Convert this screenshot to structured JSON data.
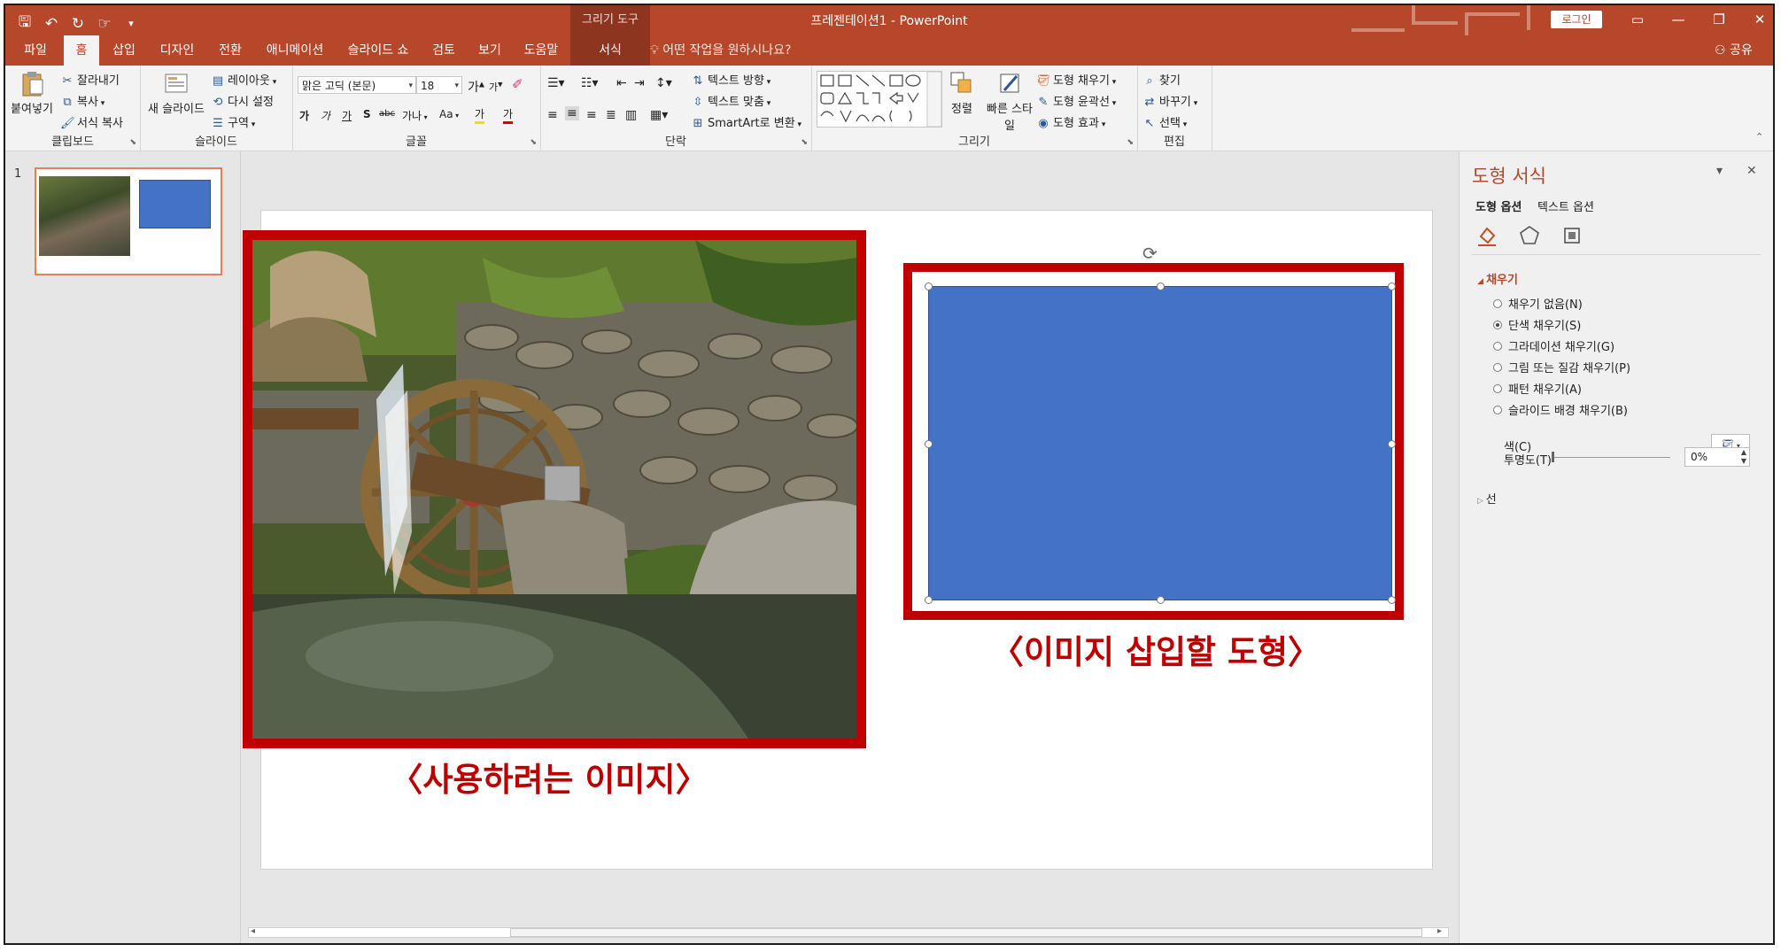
{
  "titlebar": {
    "doc_title": "프레젠테이션1 - PowerPoint",
    "context_tool": "그리기 도구",
    "login": "로그인",
    "qat": [
      "save-icon",
      "undo-icon",
      "redo-icon",
      "touch-mode-icon",
      "customize-icon"
    ]
  },
  "tabs": {
    "file": "파일",
    "home": "홈",
    "insert": "삽입",
    "design": "디자인",
    "transitions": "전환",
    "animations": "애니메이션",
    "slideshow": "슬라이드 쇼",
    "review": "검토",
    "view": "보기",
    "help": "도움말",
    "format": "서식",
    "tell_me": "어떤 작업을 원하시나요?",
    "share": "공유"
  },
  "ribbon": {
    "clipboard": {
      "label": "클립보드",
      "paste": "붙여넣기",
      "cut": "잘라내기",
      "copy": "복사",
      "format_painter": "서식 복사"
    },
    "slides": {
      "label": "슬라이드",
      "new_slide": "새 슬라이드",
      "layout": "레이아웃",
      "reset": "다시 설정",
      "section": "구역"
    },
    "font": {
      "label": "글꼴",
      "font_name": "맑은 고딕 (본문)",
      "font_size": "18",
      "grow": "가",
      "shrink": "가",
      "bold": "가",
      "italic": "가",
      "underline": "가",
      "shadow": "S",
      "strike": "abc",
      "spacing": "가나",
      "case": "Aa",
      "highlight": "가",
      "color": "가"
    },
    "paragraph": {
      "label": "단락",
      "text_direction": "텍스트 방향",
      "align_text": "텍스트 맞춤",
      "smartart": "SmartArt로 변환"
    },
    "drawing": {
      "label": "그리기",
      "arrange": "정렬",
      "quick_styles": "빠른 스타일",
      "shape_fill": "도형 채우기",
      "shape_outline": "도형 윤곽선",
      "shape_effects": "도형 효과"
    },
    "editing": {
      "label": "편집",
      "find": "찾기",
      "replace": "바꾸기",
      "select": "선택"
    }
  },
  "thumbnails": {
    "slide_number": "1"
  },
  "slide": {
    "caption_image": "〈사용하려는 이미지〉",
    "caption_shape": "〈이미지 삽입할 도형〉",
    "shape_color": "#4472c4",
    "highlight_color": "#c00000"
  },
  "pane": {
    "title": "도형 서식",
    "shape_options": "도형 옵션",
    "text_options": "텍스트 옵션",
    "fill_section": "채우기",
    "fill_options": [
      {
        "label": "채우기 없음(N)",
        "selected": false
      },
      {
        "label": "단색 채우기(S)",
        "selected": true
      },
      {
        "label": "그라데이션 채우기(G)",
        "selected": false
      },
      {
        "label": "그림 또는 질감 채우기(P)",
        "selected": false
      },
      {
        "label": "패턴 채우기(A)",
        "selected": false
      },
      {
        "label": "슬라이드 배경 채우기(B)",
        "selected": false
      }
    ],
    "color_label": "색(C)",
    "transparency_label": "투명도(T)",
    "transparency_value": "0%",
    "line_section": "선"
  },
  "colors": {
    "accent": "#b7472a",
    "accent_dark": "#8d351f"
  }
}
